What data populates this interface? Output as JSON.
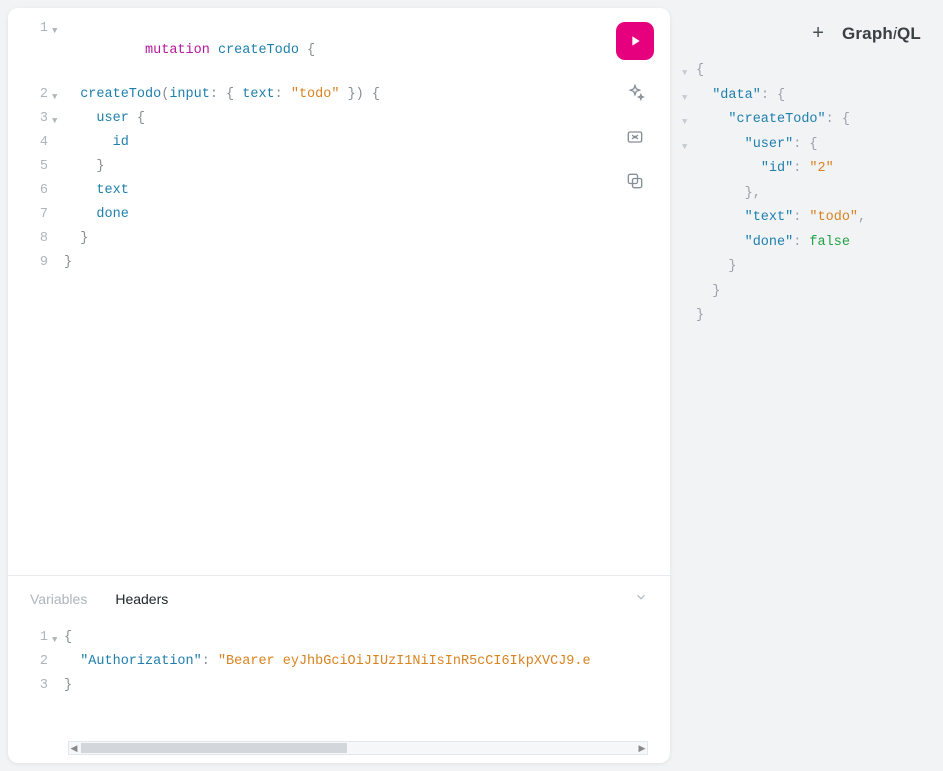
{
  "header": {
    "logo_left": "Graph",
    "logo_i": "i",
    "logo_right": "QL"
  },
  "query": {
    "lines": {
      "l1": {
        "num": "1",
        "mutation": "mutation",
        "name": "createTodo",
        "brace": " {"
      },
      "l2": {
        "num": "2",
        "indent": "  ",
        "field": "createTodo",
        "open": "(",
        "arg": "input",
        "colon": ": ",
        "obr": "{ ",
        "key": "text",
        "kcolon": ": ",
        "str": "\"todo\"",
        "cbr": " }",
        "close": ")",
        "brace": " {"
      },
      "l3": {
        "num": "3",
        "indent": "    ",
        "field": "user",
        "brace": " {"
      },
      "l4": {
        "num": "4",
        "indent": "      ",
        "field": "id"
      },
      "l5": {
        "num": "5",
        "indent": "    ",
        "brace": "}"
      },
      "l6": {
        "num": "6",
        "indent": "    ",
        "field": "text"
      },
      "l7": {
        "num": "7",
        "indent": "    ",
        "field": "done"
      },
      "l8": {
        "num": "8",
        "indent": "  ",
        "brace": "}"
      },
      "l9": {
        "num": "9",
        "brace": "}"
      }
    }
  },
  "tabs": {
    "variables": "Variables",
    "headers": "Headers"
  },
  "headers_json": {
    "l1": {
      "num": "1",
      "brace": "{"
    },
    "l2": {
      "num": "2",
      "indent": "  ",
      "key": "\"Authorization\"",
      "colon": ": ",
      "val": "\"Bearer eyJhbGciOiJIUzI1NiIsInR5cCI6IkpXVCJ9.e"
    },
    "l3": {
      "num": "3",
      "brace": "}"
    }
  },
  "result": {
    "l1": {
      "indent": "",
      "text1": "{"
    },
    "l2": {
      "indent": "  ",
      "key": "\"data\"",
      "colon": ": ",
      "brace": "{"
    },
    "l3": {
      "indent": "    ",
      "key": "\"createTodo\"",
      "colon": ": ",
      "brace": "{"
    },
    "l4": {
      "indent": "      ",
      "key": "\"user\"",
      "colon": ": ",
      "brace": "{"
    },
    "l5": {
      "indent": "        ",
      "key": "\"id\"",
      "colon": ": ",
      "val": "\"2\""
    },
    "l6": {
      "indent": "      ",
      "brace": "},"
    },
    "l7": {
      "indent": "      ",
      "key": "\"text\"",
      "colon": ": ",
      "val": "\"todo\"",
      "comma": ","
    },
    "l8": {
      "indent": "      ",
      "key": "\"done\"",
      "colon": ": ",
      "bool": "false"
    },
    "l9": {
      "indent": "    ",
      "brace": "}"
    },
    "l10": {
      "indent": "  ",
      "brace": "}"
    },
    "l11": {
      "indent": "",
      "brace": "}"
    }
  }
}
